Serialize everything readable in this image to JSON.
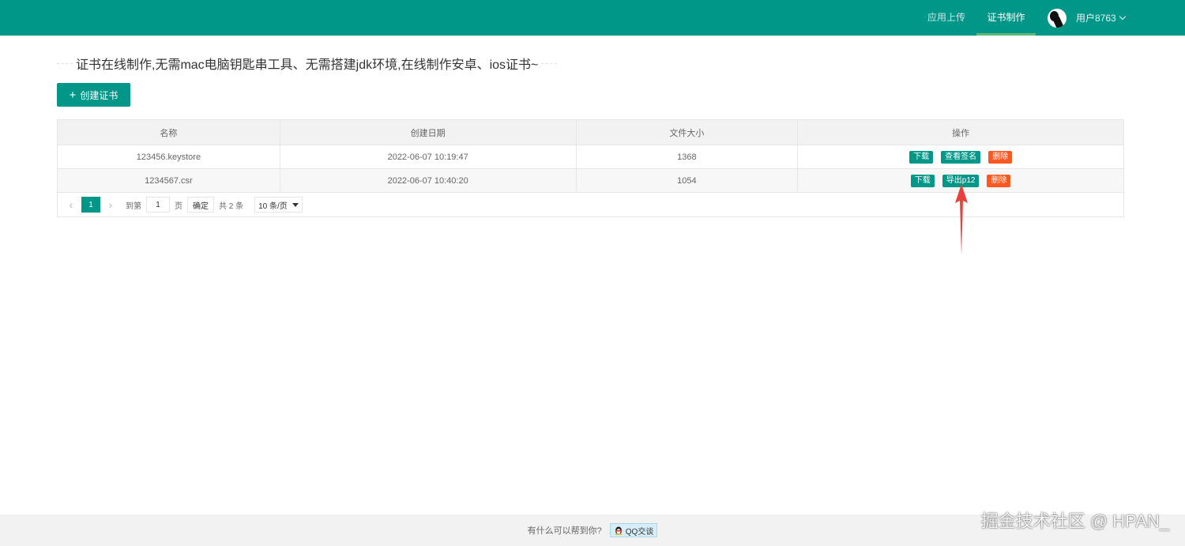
{
  "header": {
    "nav": [
      {
        "label": "应用上传",
        "active": false
      },
      {
        "label": "证书制作",
        "active": true
      }
    ],
    "user_name": "用户8763",
    "brand_color": "#009688",
    "active_indicator_color": "#5FB878"
  },
  "intro_text": "证书在线制作,无需mac电脑钥匙串工具、无需搭建jdk环境,在线制作安卓、ios证书~",
  "create_button_label": "创建证书",
  "table": {
    "headers": [
      "名称",
      "创建日期",
      "文件大小",
      "操作"
    ],
    "rows": [
      {
        "name": "123456.keystore",
        "date": "2022-06-07 10:19:47",
        "size": "1368",
        "actions": [
          "下载",
          "查看签名",
          "删除"
        ]
      },
      {
        "name": "1234567.csr",
        "date": "2022-06-07 10:40:20",
        "size": "1054",
        "actions": [
          "下载",
          "导出p12",
          "删除"
        ]
      }
    ]
  },
  "pagination": {
    "current_page": "1",
    "goto_label": "到第",
    "goto_value": "1",
    "page_unit": "页",
    "confirm_label": "确定",
    "total_label": "共 2 条",
    "page_size": "10 条/页"
  },
  "footer": {
    "help_text": "有什么可以帮到你?",
    "qq_label": "QQ交谈"
  },
  "watermark": "掘金技术社区 @ HPAN_"
}
